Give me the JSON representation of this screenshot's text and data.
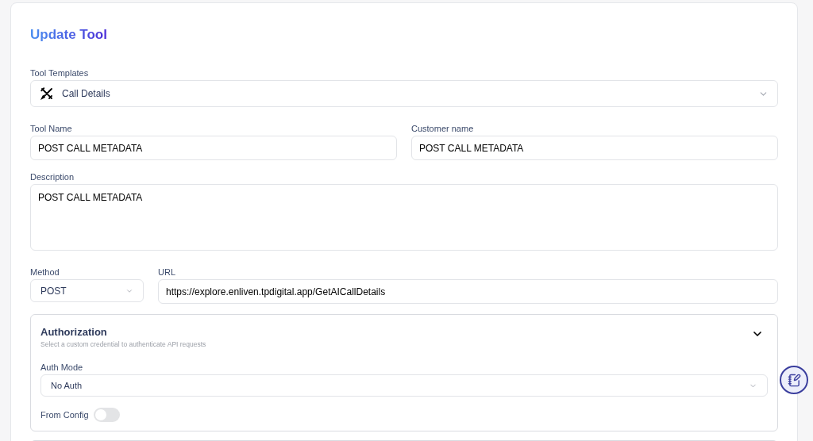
{
  "title": "Update Tool",
  "tool_templates": {
    "label": "Tool Templates",
    "value": "Call Details"
  },
  "tool_name": {
    "label": "Tool Name",
    "value": "POST CALL METADATA"
  },
  "customer_name": {
    "label": "Customer name",
    "value": "POST CALL METADATA"
  },
  "description": {
    "label": "Description",
    "value": "POST CALL METADATA"
  },
  "method": {
    "label": "Method",
    "value": "POST"
  },
  "url": {
    "label": "URL",
    "value": "https://explore.enliven.tpdigital.app/GetAICallDetails"
  },
  "authorization": {
    "title": "Authorization",
    "subtitle": "Select a custom credential to authenticate API requests",
    "expanded": true,
    "auth_mode": {
      "label": "Auth Mode",
      "value": "No Auth"
    },
    "from_config": {
      "label": "From Config",
      "on": false
    }
  }
}
